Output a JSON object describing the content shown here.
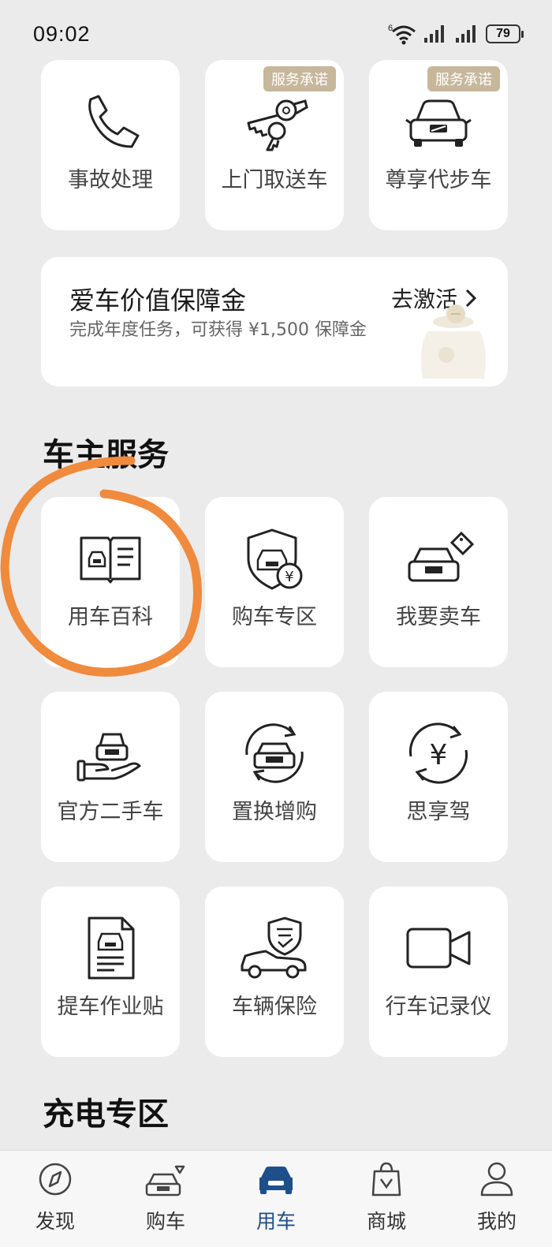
{
  "status": {
    "time": "09:02",
    "battery": "79",
    "network": "6"
  },
  "top_tiles": [
    {
      "label": "事故处理",
      "icon": "phone-icon"
    },
    {
      "label": "上门取送车",
      "icon": "keys-icon",
      "badge": "服务承诺"
    },
    {
      "label": "尊享代步车",
      "icon": "car-front-icon",
      "badge": "服务承诺"
    }
  ],
  "value_card": {
    "title": "爱车价值保障金",
    "desc": "完成年度任务，可获得 ¥1,500 保障金",
    "link": "去激活"
  },
  "sections": {
    "owner_services": "车主服务",
    "charging": "充电专区"
  },
  "owner_tiles": [
    {
      "label": "用车百科",
      "icon": "car-manual-book-icon"
    },
    {
      "label": "购车专区",
      "icon": "car-shield-yuan-icon"
    },
    {
      "label": "我要卖车",
      "icon": "car-price-tag-icon"
    },
    {
      "label": "官方二手车",
      "icon": "car-on-hand-icon"
    },
    {
      "label": "置换增购",
      "icon": "car-exchange-cycle-icon"
    },
    {
      "label": "思享驾",
      "icon": "yuan-cycle-icon"
    },
    {
      "label": "提车作业贴",
      "icon": "car-document-icon"
    },
    {
      "label": "车辆保险",
      "icon": "car-insurance-shield-icon"
    },
    {
      "label": "行车记录仪",
      "icon": "video-camera-icon"
    }
  ],
  "tabs": [
    {
      "label": "发现",
      "icon": "compass-icon"
    },
    {
      "label": "购车",
      "icon": "car-buy-icon"
    },
    {
      "label": "用车",
      "icon": "car-filled-icon",
      "active": true
    },
    {
      "label": "商城",
      "icon": "shopping-bag-icon"
    },
    {
      "label": "我的",
      "icon": "person-icon"
    }
  ],
  "colors": {
    "accent": "#1f4f8a",
    "badge": "#c7b79b",
    "annotation": "#f08a3c"
  }
}
